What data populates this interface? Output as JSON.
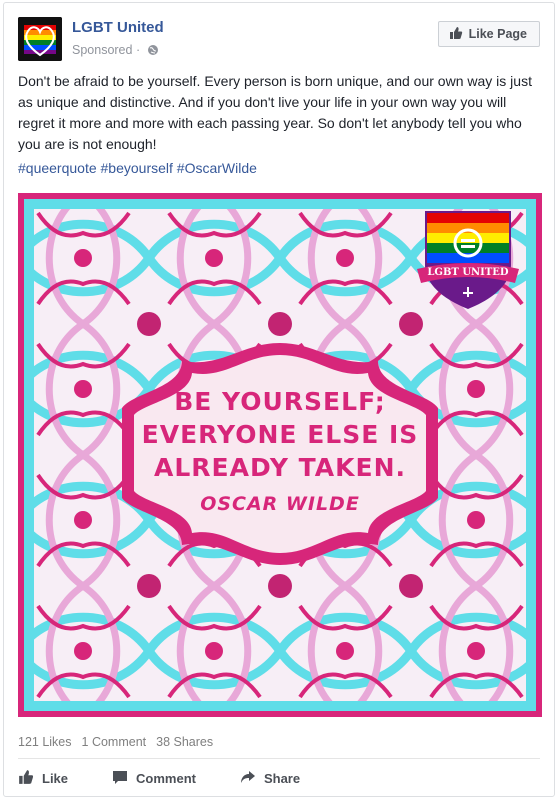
{
  "post": {
    "page_name": "LGBT United",
    "sponsored": "Sponsored",
    "like_page_label": "Like Page",
    "body": "Don't be afraid to be yourself. Every person is born unique, and our own way is just as unique and distinctive. And if you don't live your life in your own way you will regret it more and more with each passing year. So don't let anybody tell you who you are is not enough!",
    "hashtags": "#queerquote #beyourself #OscarWilde"
  },
  "image": {
    "quote_line_1": "BE YOURSELF;",
    "quote_line_2": "EVERYONE ELSE IS",
    "quote_line_3": "ALREADY TAKEN.",
    "author": "OSCAR WILDE",
    "logo_text": "LGBT UNITED",
    "colors": {
      "pink": "#d7267a",
      "cyan": "#5fdde8",
      "lavender": "#e8a8d8"
    }
  },
  "stats": {
    "likes": "121 Likes",
    "comments": "1 Comment",
    "shares": "38 Shares"
  },
  "actions": {
    "like": "Like",
    "comment": "Comment",
    "share": "Share"
  },
  "icons": [
    "globe-icon",
    "thumbs-up-icon",
    "comment-icon",
    "share-icon"
  ]
}
